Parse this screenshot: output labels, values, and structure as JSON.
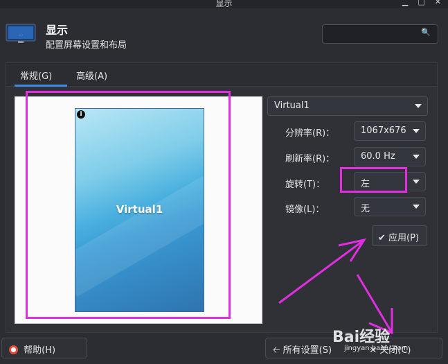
{
  "window": {
    "title": "显示",
    "buttons": [
      "▁",
      "□",
      "✕"
    ]
  },
  "header": {
    "title": "显示",
    "subtitle": "配置屏幕设置和布局",
    "search_placeholder": ""
  },
  "tabs": [
    {
      "label": "常规(G)"
    },
    {
      "label": "高级(A)"
    }
  ],
  "preview": {
    "monitor_label": "Virtual1",
    "info": "i"
  },
  "display_select": {
    "value": "Virtual1"
  },
  "settings": {
    "resolution": {
      "label": "分辨率(R)：",
      "value": "1067x676"
    },
    "refresh": {
      "label": "刷新率(R)：",
      "value": "60.0 Hz"
    },
    "rotation": {
      "label": "旋转(T)：",
      "value": "左"
    },
    "mirror": {
      "label": "镜像(L)：",
      "value": "无"
    }
  },
  "apply_button": {
    "label": "应用(P)"
  },
  "bottom": {
    "help": "帮助(H)",
    "all_settings": "所有设置(S)",
    "close": "关闭(C)"
  },
  "watermark": {
    "text": "Bai经验",
    "sub": "jingyan.baidu.com"
  },
  "colors": {
    "accent": "#3d8ee6",
    "highlight": "#e02ee0",
    "background": "#2b2d33"
  }
}
